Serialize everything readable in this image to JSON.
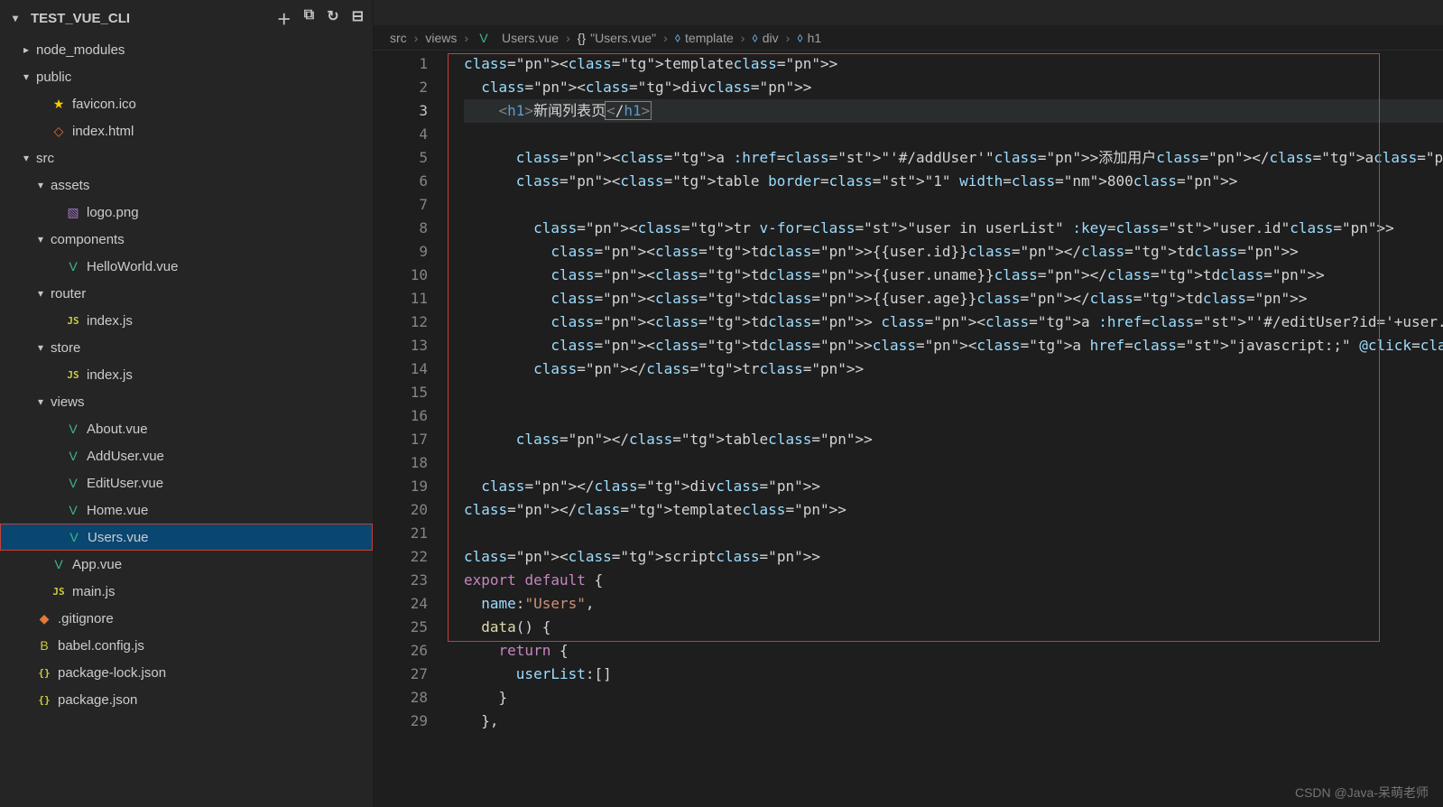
{
  "explorer": {
    "title": "TEST_VUE_CLI",
    "actions": {
      "newFile": "＋",
      "newFolder": "⧉",
      "refresh": "↻",
      "collapse": "⊟"
    },
    "tree": [
      {
        "type": "folder",
        "name": "node_modules",
        "expanded": false,
        "indent": 1
      },
      {
        "type": "folder",
        "name": "public",
        "expanded": true,
        "indent": 1
      },
      {
        "type": "file",
        "name": "favicon.ico",
        "icon": "star",
        "indent": 2
      },
      {
        "type": "file",
        "name": "index.html",
        "icon": "html",
        "indent": 2
      },
      {
        "type": "folder",
        "name": "src",
        "expanded": true,
        "indent": 1
      },
      {
        "type": "folder",
        "name": "assets",
        "expanded": true,
        "indent": 2
      },
      {
        "type": "file",
        "name": "logo.png",
        "icon": "img",
        "indent": 3
      },
      {
        "type": "folder",
        "name": "components",
        "expanded": true,
        "indent": 2
      },
      {
        "type": "file",
        "name": "HelloWorld.vue",
        "icon": "vue",
        "indent": 3
      },
      {
        "type": "folder",
        "name": "router",
        "expanded": true,
        "indent": 2
      },
      {
        "type": "file",
        "name": "index.js",
        "icon": "js",
        "indent": 3
      },
      {
        "type": "folder",
        "name": "store",
        "expanded": true,
        "indent": 2
      },
      {
        "type": "file",
        "name": "index.js",
        "icon": "js",
        "indent": 3
      },
      {
        "type": "folder",
        "name": "views",
        "expanded": true,
        "indent": 2
      },
      {
        "type": "file",
        "name": "About.vue",
        "icon": "vue",
        "indent": 3
      },
      {
        "type": "file",
        "name": "AddUser.vue",
        "icon": "vue",
        "indent": 3
      },
      {
        "type": "file",
        "name": "EditUser.vue",
        "icon": "vue",
        "indent": 3
      },
      {
        "type": "file",
        "name": "Home.vue",
        "icon": "vue",
        "indent": 3
      },
      {
        "type": "file",
        "name": "Users.vue",
        "icon": "vue",
        "indent": 3,
        "selected": true,
        "highlighted": true
      },
      {
        "type": "file",
        "name": "App.vue",
        "icon": "vue",
        "indent": 2
      },
      {
        "type": "file",
        "name": "main.js",
        "icon": "js",
        "indent": 2
      },
      {
        "type": "file",
        "name": ".gitignore",
        "icon": "git",
        "indent": 1
      },
      {
        "type": "file",
        "name": "babel.config.js",
        "icon": "babel",
        "indent": 1
      },
      {
        "type": "file",
        "name": "package-lock.json",
        "icon": "json",
        "indent": 1
      },
      {
        "type": "file",
        "name": "package.json",
        "icon": "json",
        "indent": 1
      }
    ]
  },
  "breadcrumbs": [
    {
      "text": "src",
      "kind": "path"
    },
    {
      "text": "views",
      "kind": "path"
    },
    {
      "text": "Users.vue",
      "kind": "file",
      "icon": "vue"
    },
    {
      "text": "\"Users.vue\"",
      "kind": "symbol",
      "icon": "json"
    },
    {
      "text": "template",
      "kind": "tag"
    },
    {
      "text": "div",
      "kind": "tag"
    },
    {
      "text": "h1",
      "kind": "tag"
    }
  ],
  "code": {
    "currentLine": 3,
    "lines": [
      "<template>",
      "  <div>",
      "    <h1>新闻列表页</h1>",
      "",
      "      <a :href=\"'#/addUser'\">添加用户</a>",
      "      <table border=\"1\" width=800>",
      "",
      "        <tr v-for=\"user in userList\" :key=\"user.id\">",
      "          <td>{{user.id}}</td>",
      "          <td>{{user.uname}}</td>",
      "          <td>{{user.age}}</td>",
      "          <td> <a :href=\"'#/editUser?id='+user.id\" >修改</a></td>",
      "          <td><a href=\"javascript:;\" @click=\"delRow(user.id);\">删除</a></td> <br/>",
      "        </tr>",
      "",
      "",
      "      </table>",
      "",
      "  </div>",
      "</template>",
      "",
      "<script>",
      "export default {",
      "  name:\"Users\",",
      "  data() {",
      "    return {",
      "      userList:[]",
      "    }",
      "  },"
    ]
  },
  "watermark": "CSDN @Java-呆萌老师"
}
